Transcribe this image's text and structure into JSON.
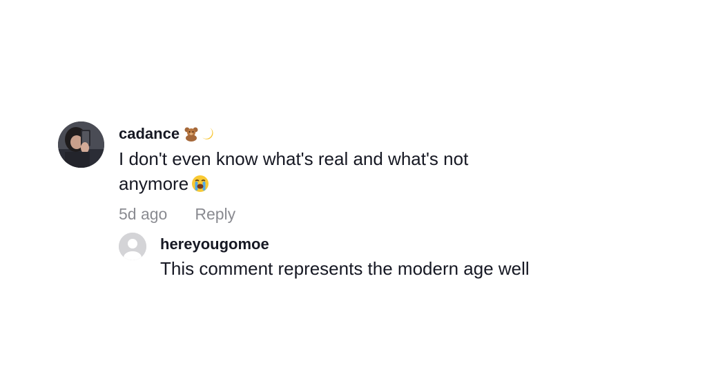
{
  "comment": {
    "username": "cadance",
    "username_emojis": [
      "teddy-bear-emoji",
      "crescent-moon-emoji"
    ],
    "text_line1": "I don't even know what's real and what's not",
    "text_line2": "anymore",
    "text_emoji": "loudly-crying-face-emoji",
    "timestamp": "5d ago",
    "reply_label": "Reply"
  },
  "reply": {
    "username": "hereyougomoe",
    "text": "This comment represents the modern age well"
  }
}
